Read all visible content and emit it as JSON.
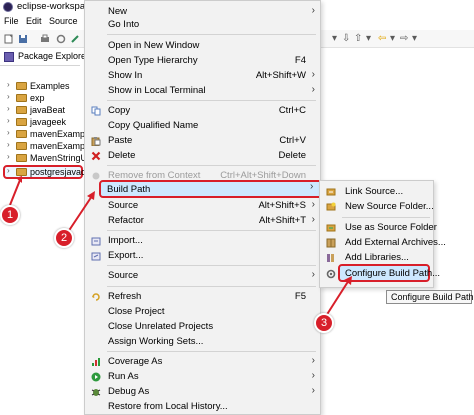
{
  "window": {
    "title": "eclipse-workspace"
  },
  "menubar": [
    "File",
    "Edit",
    "Source"
  ],
  "package_explorer": {
    "title": "Package Explorer",
    "items": [
      {
        "label": "Examples"
      },
      {
        "label": "exp"
      },
      {
        "label": "javaBeat"
      },
      {
        "label": "javageek"
      },
      {
        "label": "mavenExample"
      },
      {
        "label": "mavenExample"
      },
      {
        "label": "MavenStringUt"
      },
      {
        "label": "postgresjavaco"
      }
    ]
  },
  "context_menu": {
    "items": [
      {
        "label": "New",
        "shortcut": "",
        "submenu": true,
        "disabled": false,
        "icon": ""
      },
      {
        "label": "Go Into",
        "shortcut": "",
        "submenu": false,
        "disabled": false,
        "icon": ""
      },
      {
        "label": "Open in New Window",
        "shortcut": "",
        "submenu": false,
        "disabled": false,
        "icon": ""
      },
      {
        "label": "Open Type Hierarchy",
        "shortcut": "F4",
        "submenu": false,
        "disabled": false,
        "icon": ""
      },
      {
        "label": "Show In",
        "shortcut": "Alt+Shift+W",
        "submenu": true,
        "disabled": false,
        "icon": ""
      },
      {
        "label": "Show in Local Terminal",
        "shortcut": "",
        "submenu": true,
        "disabled": false,
        "icon": ""
      },
      {
        "label": "Copy",
        "shortcut": "Ctrl+C",
        "submenu": false,
        "disabled": false,
        "icon": "copy-icon"
      },
      {
        "label": "Copy Qualified Name",
        "shortcut": "",
        "submenu": false,
        "disabled": false,
        "icon": ""
      },
      {
        "label": "Paste",
        "shortcut": "Ctrl+V",
        "submenu": false,
        "disabled": false,
        "icon": "paste-icon"
      },
      {
        "label": "Delete",
        "shortcut": "Delete",
        "submenu": false,
        "disabled": false,
        "icon": "delete-icon"
      },
      {
        "label": "Remove from Context",
        "shortcut": "Ctrl+Alt+Shift+Down",
        "submenu": false,
        "disabled": true,
        "icon": "remove-context-icon"
      },
      {
        "label": "Build Path",
        "shortcut": "",
        "submenu": true,
        "disabled": false,
        "icon": ""
      },
      {
        "label": "Source",
        "shortcut": "Alt+Shift+S",
        "submenu": true,
        "disabled": false,
        "icon": ""
      },
      {
        "label": "Refactor",
        "shortcut": "Alt+Shift+T",
        "submenu": true,
        "disabled": false,
        "icon": ""
      },
      {
        "label": "Import...",
        "shortcut": "",
        "submenu": false,
        "disabled": false,
        "icon": "import-icon"
      },
      {
        "label": "Export...",
        "shortcut": "",
        "submenu": false,
        "disabled": false,
        "icon": "export-icon"
      },
      {
        "label": "Source",
        "shortcut": "",
        "submenu": true,
        "disabled": false,
        "icon": ""
      },
      {
        "label": "Refresh",
        "shortcut": "F5",
        "submenu": false,
        "disabled": false,
        "icon": "refresh-icon"
      },
      {
        "label": "Close Project",
        "shortcut": "",
        "submenu": false,
        "disabled": false,
        "icon": ""
      },
      {
        "label": "Close Unrelated Projects",
        "shortcut": "",
        "submenu": false,
        "disabled": false,
        "icon": ""
      },
      {
        "label": "Assign Working Sets...",
        "shortcut": "",
        "submenu": false,
        "disabled": false,
        "icon": ""
      },
      {
        "label": "Coverage As",
        "shortcut": "",
        "submenu": true,
        "disabled": false,
        "icon": "coverage-icon"
      },
      {
        "label": "Run As",
        "shortcut": "",
        "submenu": true,
        "disabled": false,
        "icon": "run-icon"
      },
      {
        "label": "Debug As",
        "shortcut": "",
        "submenu": true,
        "disabled": false,
        "icon": "debug-icon"
      },
      {
        "label": "Restore from Local History...",
        "shortcut": "",
        "submenu": false,
        "disabled": false,
        "icon": ""
      }
    ]
  },
  "build_path_submenu": {
    "items": [
      {
        "label": "Link Source...",
        "icon": "link-source-icon"
      },
      {
        "label": "New Source Folder...",
        "icon": "new-source-folder-icon"
      },
      {
        "label": "Use as Source Folder",
        "icon": "source-folder-icon"
      },
      {
        "label": "Add External Archives...",
        "icon": "external-archive-icon"
      },
      {
        "label": "Add Libraries...",
        "icon": "library-icon"
      },
      {
        "label": "Configure Build Path...",
        "icon": "configure-build-path-icon"
      }
    ]
  },
  "tooltip": {
    "text": "Configure Build Path"
  },
  "steps": [
    "1",
    "2",
    "3"
  ],
  "colors": {
    "highlight_red": "#d81f2a",
    "menu_bg": "#f2f2f2",
    "selection_blue": "#cde8ff"
  }
}
